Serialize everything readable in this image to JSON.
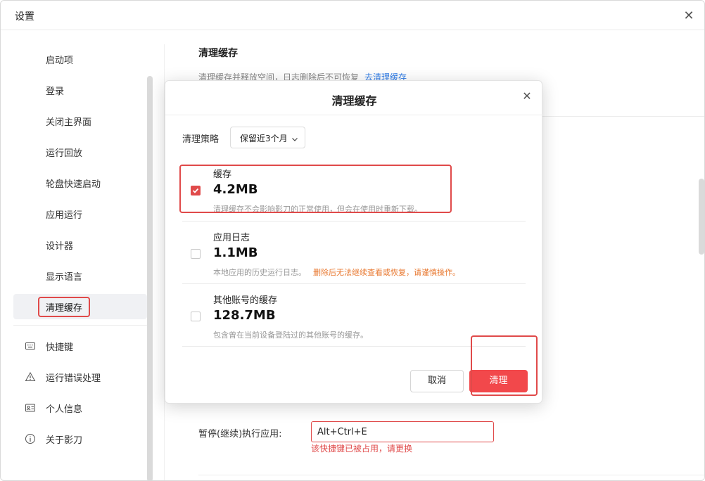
{
  "window": {
    "title": "设置"
  },
  "sidebar": {
    "items": [
      {
        "label": "启动项"
      },
      {
        "label": "登录"
      },
      {
        "label": "关闭主界面"
      },
      {
        "label": "运行回放"
      },
      {
        "label": "轮盘快速启动"
      },
      {
        "label": "应用运行"
      },
      {
        "label": "设计器"
      },
      {
        "label": "显示语言"
      },
      {
        "label": "清理缓存",
        "active": true
      }
    ],
    "secondary": [
      {
        "label": "快捷键",
        "icon": "keyboard-icon"
      },
      {
        "label": "运行错误处理",
        "icon": "warning-icon"
      },
      {
        "label": "个人信息",
        "icon": "id-card-icon"
      },
      {
        "label": "关于影刀",
        "icon": "info-icon"
      }
    ]
  },
  "content": {
    "section_title": "清理缓存",
    "section_desc": "清理缓存并释放空间，日志删除后不可恢复",
    "section_link": "去清理缓存",
    "shortcut": {
      "label": "暂停(继续)执行应用:",
      "value": "Alt+Ctrl+E",
      "error": "该快捷键已被占用，请更换"
    }
  },
  "dialog": {
    "title": "清理缓存",
    "strategy_label": "清理策略",
    "strategy_value": "保留近3个月",
    "items": [
      {
        "name": "缓存",
        "size": "4.2MB",
        "desc": "清理缓存不会影响影刀的正常使用，但会在使用时重新下载。",
        "checked": true
      },
      {
        "name": "应用日志",
        "size": "1.1MB",
        "desc": "本地应用的历史运行日志。",
        "warning": "删除后无法继续查看或恢复，请谨慎操作。",
        "checked": false
      },
      {
        "name": "其他账号的缓存",
        "size": "128.7MB",
        "desc": "包含曾在当前设备登陆过的其他账号的缓存。",
        "checked": false
      }
    ],
    "cancel_label": "取消",
    "confirm_label": "清理"
  },
  "colors": {
    "accent": "#f2484b",
    "link": "#2e7be6",
    "warning": "#e8772e",
    "highlight_box": "#e04a4a"
  }
}
